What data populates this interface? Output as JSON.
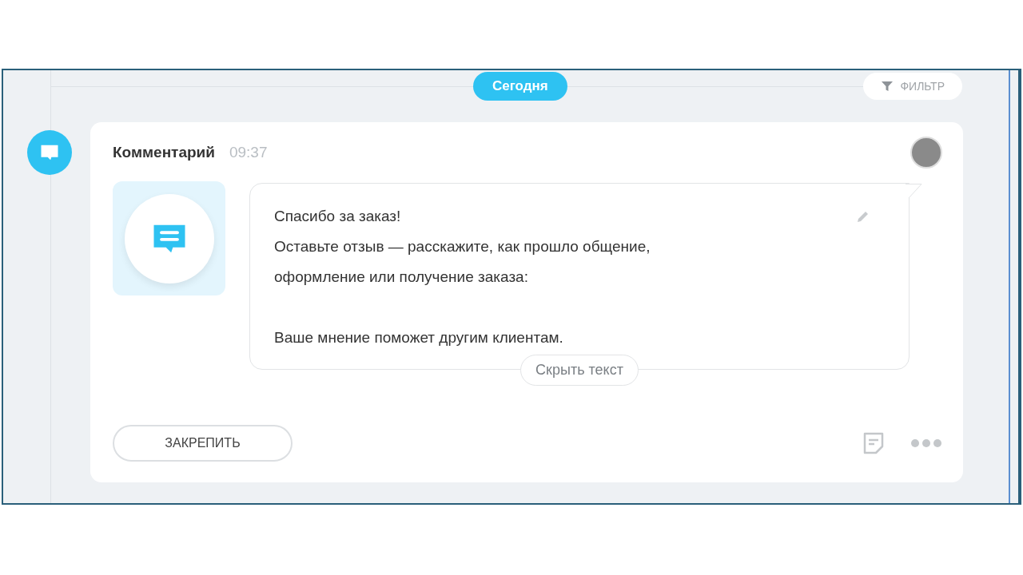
{
  "date_divider": {
    "label": "Сегодня"
  },
  "filter_button": {
    "label": "ФИЛЬТР"
  },
  "comment": {
    "title": "Комментарий",
    "time": "09:37",
    "message": [
      {
        "lines": [
          "Спасибо за заказ!",
          "Оставьте отзыв — расскажите, как прошло общение,",
          "оформление или получение заказа:"
        ]
      },
      {
        "lines": [
          "Ваше мнение поможет другим клиентам."
        ]
      }
    ],
    "collapse_button": "Скрыть текст",
    "pin_button": "ЗАКРЕПИТЬ"
  }
}
